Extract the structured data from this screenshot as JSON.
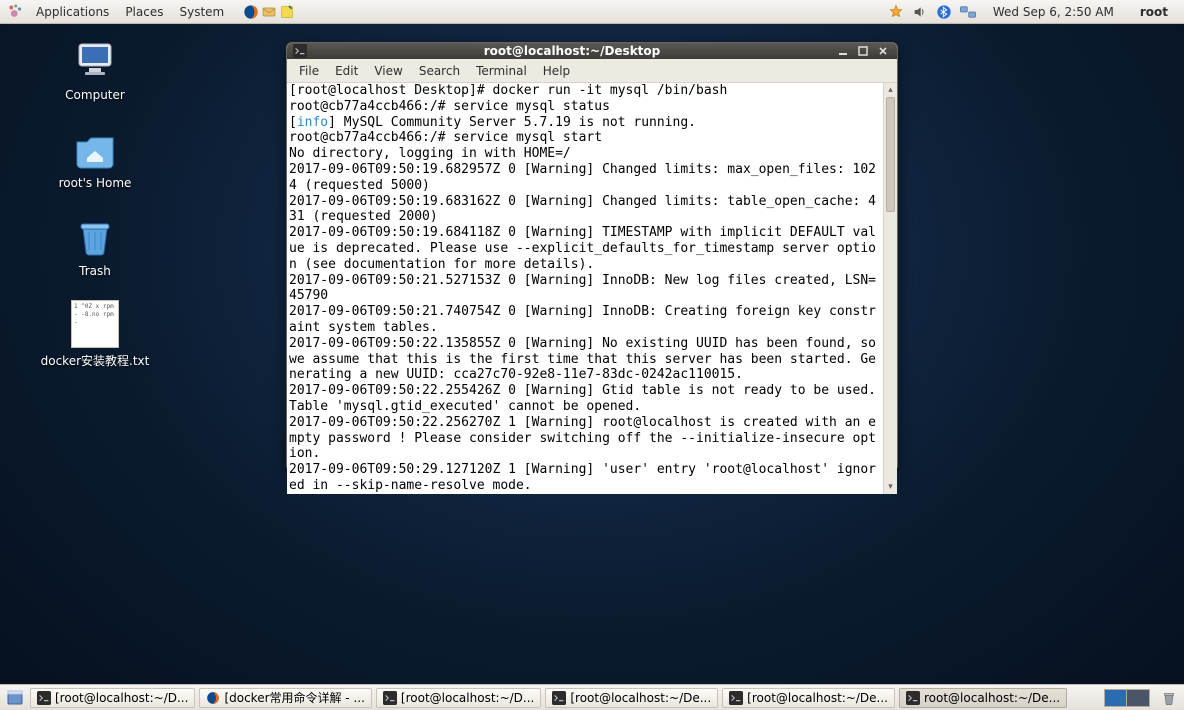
{
  "panel": {
    "menus": [
      "Applications",
      "Places",
      "System"
    ],
    "clock": "Wed Sep  6,  2:50 AM",
    "user": "root",
    "tray_icons": [
      "firefox-icon",
      "mail-icon",
      "notes-icon",
      "update-star-icon",
      "volume-icon",
      "bluetooth-icon",
      "network-icon"
    ]
  },
  "desktop": {
    "icons": [
      {
        "name": "computer-icon",
        "label": "Computer"
      },
      {
        "name": "home-folder-icon",
        "label": "root's Home"
      },
      {
        "name": "trash-icon",
        "label": "Trash"
      },
      {
        "name": "text-file-icon",
        "label": "docker安装教程.txt",
        "thumb": "1 ^0Z x\nrpm -\n-8.no\nrpm -"
      }
    ]
  },
  "window": {
    "title": "root@localhost:~/Desktop",
    "menus": [
      "File",
      "Edit",
      "View",
      "Search",
      "Terminal",
      "Help"
    ],
    "lines": [
      {
        "t": "[root@localhost Desktop]# docker run -it mysql /bin/bash"
      },
      {
        "t": "root@cb77a4ccb466:/# service mysql status"
      },
      {
        "pre": "[",
        "info": "info",
        "post": "] MySQL Community Server 5.7.19 is not running."
      },
      {
        "t": "root@cb77a4ccb466:/# service mysql start"
      },
      {
        "t": "No directory, logging in with HOME=/"
      },
      {
        "t": "2017-09-06T09:50:19.682957Z 0 [Warning] Changed limits: max_open_files: 1024 (requested 5000)"
      },
      {
        "t": "2017-09-06T09:50:19.683162Z 0 [Warning] Changed limits: table_open_cache: 431 (requested 2000)"
      },
      {
        "t": "2017-09-06T09:50:19.684118Z 0 [Warning] TIMESTAMP with implicit DEFAULT value is deprecated. Please use --explicit_defaults_for_timestamp server option (see documentation for more details)."
      },
      {
        "t": "2017-09-06T09:50:21.527153Z 0 [Warning] InnoDB: New log files created, LSN=45790"
      },
      {
        "t": "2017-09-06T09:50:21.740754Z 0 [Warning] InnoDB: Creating foreign key constraint system tables."
      },
      {
        "t": "2017-09-06T09:50:22.135855Z 0 [Warning] No existing UUID has been found, so we assume that this is the first time that this server has been started. Generating a new UUID: cca27c70-92e8-11e7-83dc-0242ac110015."
      },
      {
        "t": "2017-09-06T09:50:22.255426Z 0 [Warning] Gtid table is not ready to be used. Table 'mysql.gtid_executed' cannot be opened."
      },
      {
        "t": "2017-09-06T09:50:22.256270Z 1 [Warning] root@localhost is created with an empty password ! Please consider switching off the --initialize-insecure option."
      },
      {
        "t": "2017-09-06T09:50:29.127120Z 1 [Warning] 'user' entry 'root@localhost' ignored in --skip-name-resolve mode."
      }
    ]
  },
  "taskbar": {
    "tasks": [
      {
        "icon": "terminal-icon",
        "label": "[root@localhost:~/D..."
      },
      {
        "icon": "firefox-icon",
        "label": "[docker常用命令详解 - ..."
      },
      {
        "icon": "terminal-icon",
        "label": "[root@localhost:~/D..."
      },
      {
        "icon": "terminal-icon",
        "label": "[root@localhost:~/De..."
      },
      {
        "icon": "terminal-icon",
        "label": "[root@localhost:~/De..."
      },
      {
        "icon": "terminal-icon",
        "label": "root@localhost:~/De...",
        "active": true
      }
    ],
    "workspaces": 2,
    "active_ws": 0
  }
}
